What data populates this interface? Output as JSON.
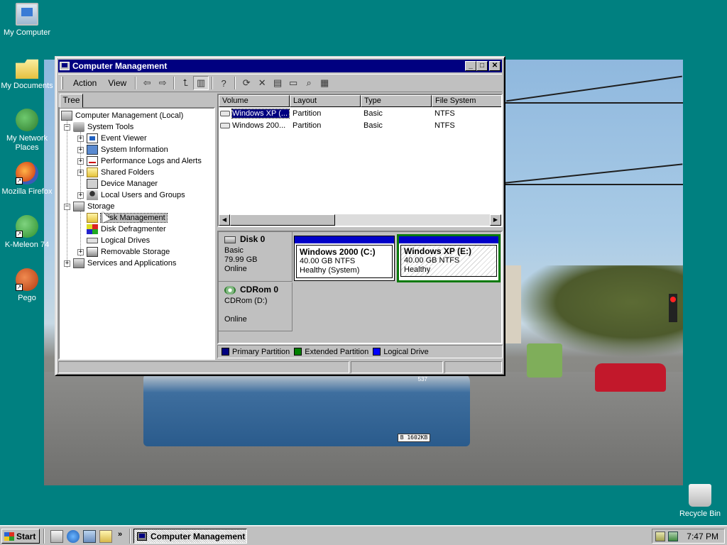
{
  "desktop": {
    "icons": [
      {
        "label": "My Computer",
        "icon": "my-computer-icon"
      },
      {
        "label": "My Documents",
        "icon": "my-documents-icon"
      },
      {
        "label": "My Network Places",
        "icon": "network-places-icon"
      },
      {
        "label": "Mozilla Firefox",
        "icon": "firefox-icon"
      },
      {
        "label": "K-Meleon 74",
        "icon": "kmeleon-icon"
      },
      {
        "label": "Pego",
        "icon": "pego-icon"
      },
      {
        "label": "Recycle Bin",
        "icon": "recycle-bin-icon"
      }
    ],
    "wallpaper": {
      "plate_text": "B 1602KB",
      "bus_number": "537"
    },
    "background_color": "#008080"
  },
  "window": {
    "title": "Computer Management",
    "controls": {
      "minimize": "_",
      "maximize": "□",
      "close": "✕"
    },
    "menu": {
      "action": "Action",
      "view": "View"
    },
    "toolbar_icons": [
      "back-arrow-icon",
      "forward-arrow-icon",
      "up-folder-icon",
      "show-hide-tree-icon",
      "help-icon",
      "refresh-icon",
      "delete-icon",
      "properties-icon",
      "open-icon",
      "find-icon",
      "settings-icon"
    ],
    "tab": "Tree",
    "tree": {
      "root": "Computer Management (Local)",
      "system_tools": "System Tools",
      "event_viewer": "Event Viewer",
      "system_information": "System Information",
      "perf_logs": "Performance Logs and Alerts",
      "shared_folders": "Shared Folders",
      "device_manager": "Device Manager",
      "local_users": "Local Users and Groups",
      "storage": "Storage",
      "disk_management": "Disk Management",
      "disk_defragmenter": "Disk Defragmenter",
      "logical_drives": "Logical Drives",
      "removable_storage": "Removable Storage",
      "services_apps": "Services and Applications"
    },
    "volume_list": {
      "headers": {
        "volume": "Volume",
        "layout": "Layout",
        "type": "Type",
        "file_system": "File System"
      },
      "rows": [
        {
          "volume": "Windows XP (...",
          "layout": "Partition",
          "type": "Basic",
          "fs": "NTFS",
          "selected": true
        },
        {
          "volume": "Windows 200...",
          "layout": "Partition",
          "type": "Basic",
          "fs": "NTFS",
          "selected": false
        }
      ]
    },
    "disks": {
      "disk0": {
        "name": "Disk 0",
        "kind": "Basic",
        "size": "79.99 GB",
        "status": "Online"
      },
      "cdrom0": {
        "name": "CDRom 0",
        "kind": "CDRom (D:)",
        "status": "Online"
      },
      "partitions": [
        {
          "title": "Windows 2000  (C:)",
          "size": "40.00 GB NTFS",
          "status": "Healthy (System)"
        },
        {
          "title": "Windows XP  (E:)",
          "size": "40.00 GB NTFS",
          "status": "Healthy"
        }
      ]
    },
    "legend": [
      {
        "label": "Primary Partition",
        "color": "#000080"
      },
      {
        "label": "Extended Partition",
        "color": "#008000"
      },
      {
        "label": "Logical Drive",
        "color": "#0000ff"
      }
    ]
  },
  "taskbar": {
    "start": "Start",
    "quick_launch": [
      "show-desktop-icon",
      "internet-explorer-icon",
      "outlook-express-icon",
      "search-icon"
    ],
    "chevron": "»",
    "task_button": "Computer Management",
    "clock": "7:47 PM"
  }
}
